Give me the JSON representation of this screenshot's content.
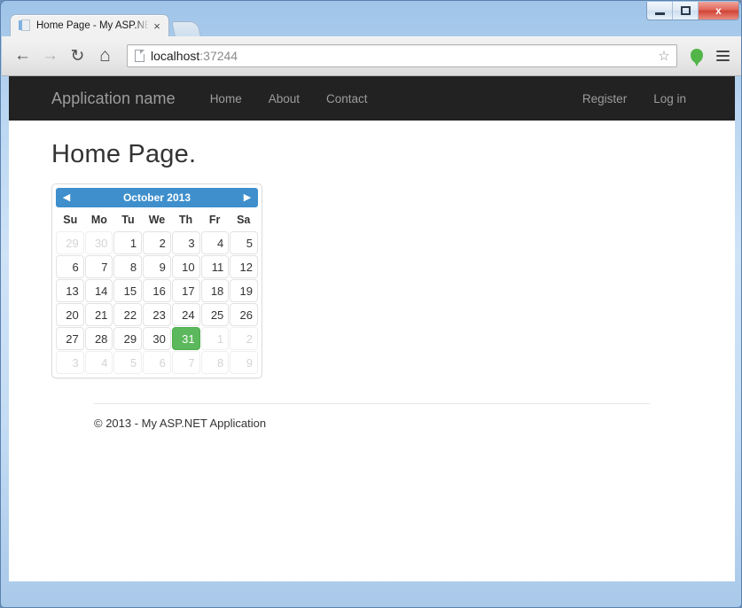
{
  "window": {
    "controls": {
      "minimize_label": "Minimize",
      "maximize_label": "Restore",
      "close_label": "x"
    }
  },
  "browser": {
    "tab": {
      "title": "Home Page - My ASP.NET Application",
      "close_label": "×"
    },
    "toolbar": {
      "back_label": "←",
      "forward_label": "→",
      "reload_label": "↻",
      "home_label": "⌂",
      "star_label": "☆",
      "url_host": "localhost",
      "url_port": ":37244",
      "url_full": "localhost:37244"
    }
  },
  "site": {
    "brand": "Application name",
    "nav": [
      {
        "label": "Home"
      },
      {
        "label": "About"
      },
      {
        "label": "Contact"
      }
    ],
    "nav_right": [
      {
        "label": "Register"
      },
      {
        "label": "Log in"
      }
    ],
    "page_title": "Home Page.",
    "footer": "© 2013 - My ASP.NET Application"
  },
  "datepicker": {
    "prev_label": "◀",
    "next_label": "▶",
    "month_title": "October 2013",
    "day_headers": [
      "Su",
      "Mo",
      "Tu",
      "We",
      "Th",
      "Fr",
      "Sa"
    ],
    "selected_date": "31",
    "accent_header_color": "#3e8fcc",
    "accent_selected_color": "#5cb85c",
    "weeks": [
      [
        {
          "n": "29",
          "state": "muted"
        },
        {
          "n": "30",
          "state": "muted"
        },
        {
          "n": "1",
          "state": "normal"
        },
        {
          "n": "2",
          "state": "normal"
        },
        {
          "n": "3",
          "state": "normal"
        },
        {
          "n": "4",
          "state": "normal"
        },
        {
          "n": "5",
          "state": "normal"
        }
      ],
      [
        {
          "n": "6",
          "state": "normal"
        },
        {
          "n": "7",
          "state": "normal"
        },
        {
          "n": "8",
          "state": "normal"
        },
        {
          "n": "9",
          "state": "normal"
        },
        {
          "n": "10",
          "state": "normal"
        },
        {
          "n": "11",
          "state": "normal"
        },
        {
          "n": "12",
          "state": "normal"
        }
      ],
      [
        {
          "n": "13",
          "state": "normal"
        },
        {
          "n": "14",
          "state": "normal"
        },
        {
          "n": "15",
          "state": "normal"
        },
        {
          "n": "16",
          "state": "normal"
        },
        {
          "n": "17",
          "state": "normal"
        },
        {
          "n": "18",
          "state": "normal"
        },
        {
          "n": "19",
          "state": "normal"
        }
      ],
      [
        {
          "n": "20",
          "state": "normal"
        },
        {
          "n": "21",
          "state": "normal"
        },
        {
          "n": "22",
          "state": "normal"
        },
        {
          "n": "23",
          "state": "normal"
        },
        {
          "n": "24",
          "state": "normal"
        },
        {
          "n": "25",
          "state": "normal"
        },
        {
          "n": "26",
          "state": "normal"
        }
      ],
      [
        {
          "n": "27",
          "state": "normal"
        },
        {
          "n": "28",
          "state": "normal"
        },
        {
          "n": "29",
          "state": "normal"
        },
        {
          "n": "30",
          "state": "normal"
        },
        {
          "n": "31",
          "state": "active"
        },
        {
          "n": "1",
          "state": "muted"
        },
        {
          "n": "2",
          "state": "muted"
        }
      ],
      [
        {
          "n": "3",
          "state": "muted"
        },
        {
          "n": "4",
          "state": "muted"
        },
        {
          "n": "5",
          "state": "muted"
        },
        {
          "n": "6",
          "state": "muted"
        },
        {
          "n": "7",
          "state": "muted"
        },
        {
          "n": "8",
          "state": "muted"
        },
        {
          "n": "9",
          "state": "muted"
        }
      ]
    ]
  }
}
